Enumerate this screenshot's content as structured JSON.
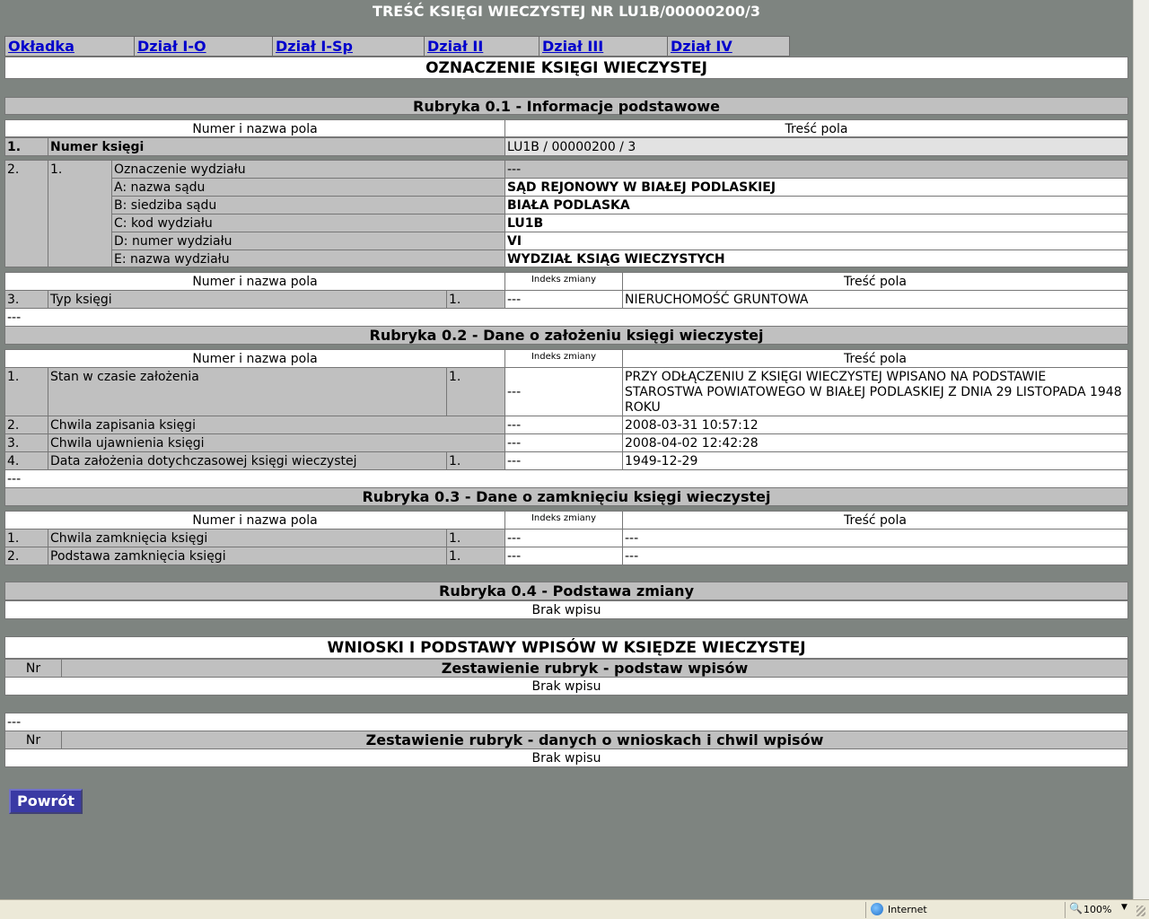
{
  "window_title": "TREŚĆ KSIĘGI WIECZYSTEJ NR LU1B/00000200/3",
  "tabs": [
    "Okładka",
    "Dział I-O",
    "Dział I-Sp",
    "Dział II",
    "Dział III",
    "Dział IV"
  ],
  "main_heading": "OZNACZENIE KSIĘGI WIECZYSTEJ",
  "dash": "---",
  "headers": {
    "name_col": "Numer i nazwa pola",
    "content_col": "Treść pola",
    "index_col": "Indeks zmiany",
    "nr_col": "Nr"
  },
  "rubric_01": {
    "title": "Rubryka 0.1 - Informacje podstawowe",
    "book_number": {
      "num": "1.",
      "label": "Numer księgi",
      "value": "LU1B / 00000200 / 3"
    },
    "department": {
      "num": "2.",
      "sub": "1.",
      "label": "Oznaczenie wydziału",
      "value": "---",
      "rows": [
        {
          "label": "A: nazwa sądu",
          "value": "SĄD REJONOWY W BIAŁEJ PODLASKIEJ"
        },
        {
          "label": "B: siedziba sądu",
          "value": "BIAŁA PODLASKA"
        },
        {
          "label": "C: kod wydziału",
          "value": "LU1B"
        },
        {
          "label": "D: numer wydziału",
          "value": "VI"
        },
        {
          "label": "E: nazwa wydziału",
          "value": "WYDZIAŁ KSIĄG WIECZYSTYCH"
        }
      ]
    },
    "type_row": {
      "num": "3.",
      "label": "Typ księgi",
      "sub": "1.",
      "index": "---",
      "value": "NIERUCHOMOŚĆ GRUNTOWA"
    }
  },
  "rubric_02": {
    "title": "Rubryka 0.2 - Dane o założeniu księgi wieczystej",
    "rows": [
      {
        "num": "1.",
        "label": "Stan w czasie założenia",
        "sub": "1.",
        "index": "---",
        "value": "PRZY ODŁĄCZENIU Z KSIĘGI WIECZYSTEJ WPISANO NA PODSTAWIE STAROSTWA POWIATOWEGO W BIAŁEJ PODLASKIEJ Z DNIA 29 LISTOPADA 1948 ROKU"
      },
      {
        "num": "2.",
        "label": "Chwila zapisania księgi",
        "index": "---",
        "value": "2008-03-31 10:57:12"
      },
      {
        "num": "3.",
        "label": "Chwila ujawnienia księgi",
        "index": "---",
        "value": "2008-04-02 12:42:28"
      },
      {
        "num": "4.",
        "label": "Data założenia dotychczasowej księgi wieczystej",
        "sub": "1.",
        "index": "---",
        "value": "1949-12-29"
      }
    ]
  },
  "rubric_03": {
    "title": "Rubryka 0.3 - Dane o zamknięciu księgi wieczystej",
    "rows": [
      {
        "num": "1.",
        "label": "Chwila zamknięcia księgi",
        "sub": "1.",
        "index": "---",
        "value": "---"
      },
      {
        "num": "2.",
        "label": "Podstawa zamknięcia księgi",
        "sub": "1.",
        "index": "---",
        "value": "---"
      }
    ]
  },
  "rubric_04": {
    "title": "Rubryka 0.4 - Podstawa zmiany",
    "empty": "Brak wpisu"
  },
  "applications": {
    "heading": "WNIOSKI I PODSTAWY WPISÓW W KSIĘDZE WIECZYSTEJ",
    "summary1_title": "Zestawienie rubryk - podstaw wpisów",
    "summary1_empty": "Brak wpisu",
    "summary2_title": "Zestawienie rubryk - danych o wnioskach i chwil wpisów",
    "summary2_empty": "Brak wpisu"
  },
  "back_button": "Powrót",
  "statusbar": {
    "zone": "Internet",
    "zoom": "100%"
  }
}
